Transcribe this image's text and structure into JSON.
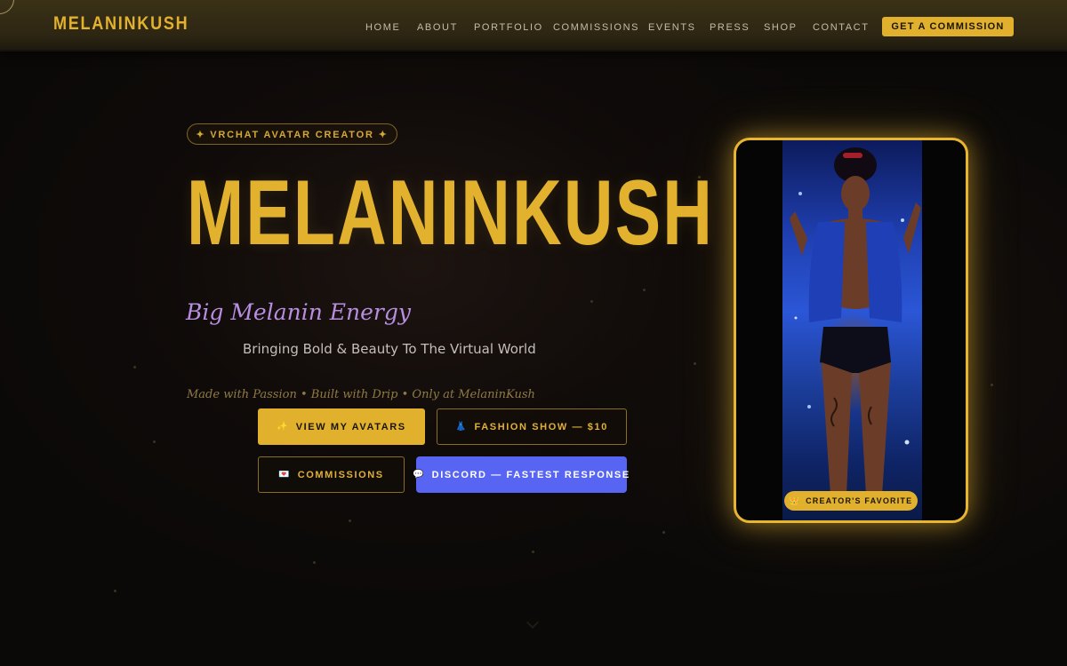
{
  "brand": {
    "logo": "MELANINKUSH"
  },
  "nav": {
    "links": [
      "HOME",
      "ABOUT",
      "PORTFOLIO",
      "COMMISSIONS",
      "EVENTS",
      "PRESS",
      "SHOP",
      "CONTACT"
    ],
    "cta": "GET A COMMISSION"
  },
  "hero": {
    "badge": "✦ VRCHAT AVATAR CREATOR ✦",
    "title": "MELANINKUSH",
    "tagline": "Big Melanin Energy",
    "subline": "Bringing Bold & Beauty To The Virtual World",
    "motto": "Made with Passion • Built with Drip • Only at MelaninKush"
  },
  "buttons": {
    "view_avatars": {
      "icon": "✨",
      "label": "VIEW MY AVATARS"
    },
    "fashion_show": {
      "icon": "👗",
      "label": "FASHION SHOW — $10"
    },
    "commissions": {
      "icon": "💌",
      "label": "COMMISSIONS"
    },
    "discord": {
      "icon": "💬",
      "label": "DISCORD — FASTEST RESPONSE"
    }
  },
  "showcase": {
    "badge_icon": "👑",
    "badge": "CREATOR'S FAVORITE"
  },
  "icons": {
    "scroll": "chevron-down-icon"
  },
  "colors": {
    "accent": "#e1b12e",
    "tagline": "#b88ee0",
    "discord": "#5865f2",
    "background": "#0b0908"
  }
}
